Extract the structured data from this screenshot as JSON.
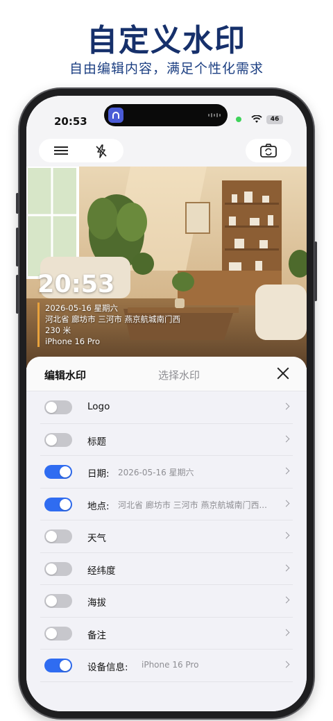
{
  "promo": {
    "title": "自定义水印",
    "subtitle": "自由编辑内容，满足个性化需求"
  },
  "status_bar": {
    "time": "20:53",
    "battery": "46"
  },
  "toolbar": {
    "menu_icon": "menu-icon",
    "flash_icon": "flash-off-icon",
    "camera_switch_icon": "switch-camera-icon"
  },
  "watermark": {
    "time": "20:53",
    "date_line": "2026-05-16 星期六",
    "location_line": "河北省 廊坊市 三河市 燕京航城南门西",
    "altitude_line": "230 米",
    "device_line": "iPhone 16 Pro",
    "accent_color": "#e8a23c"
  },
  "sheet": {
    "tab_edit": "编辑水印",
    "tab_select": "选择水印",
    "close_icon": "close-icon",
    "rows": [
      {
        "label": "Logo",
        "value": "",
        "enabled": false
      },
      {
        "label": "标题",
        "value": "",
        "enabled": false
      },
      {
        "label": "日期:",
        "value": "2026-05-16 星期六",
        "enabled": true
      },
      {
        "label": "地点:",
        "value": "河北省 廊坊市 三河市 燕京航城南门西...",
        "enabled": true
      },
      {
        "label": "天气",
        "value": "",
        "enabled": false
      },
      {
        "label": "经纬度",
        "value": "",
        "enabled": false
      },
      {
        "label": "海拔",
        "value": "",
        "enabled": false
      },
      {
        "label": "备注",
        "value": "",
        "enabled": false
      },
      {
        "label": "设备信息:",
        "value": "iPhone 16 Pro",
        "enabled": true
      }
    ]
  },
  "colors": {
    "promo_title": "#16306b",
    "toggle_on": "#2f6cf1",
    "toggle_off": "#c7c7cc"
  }
}
